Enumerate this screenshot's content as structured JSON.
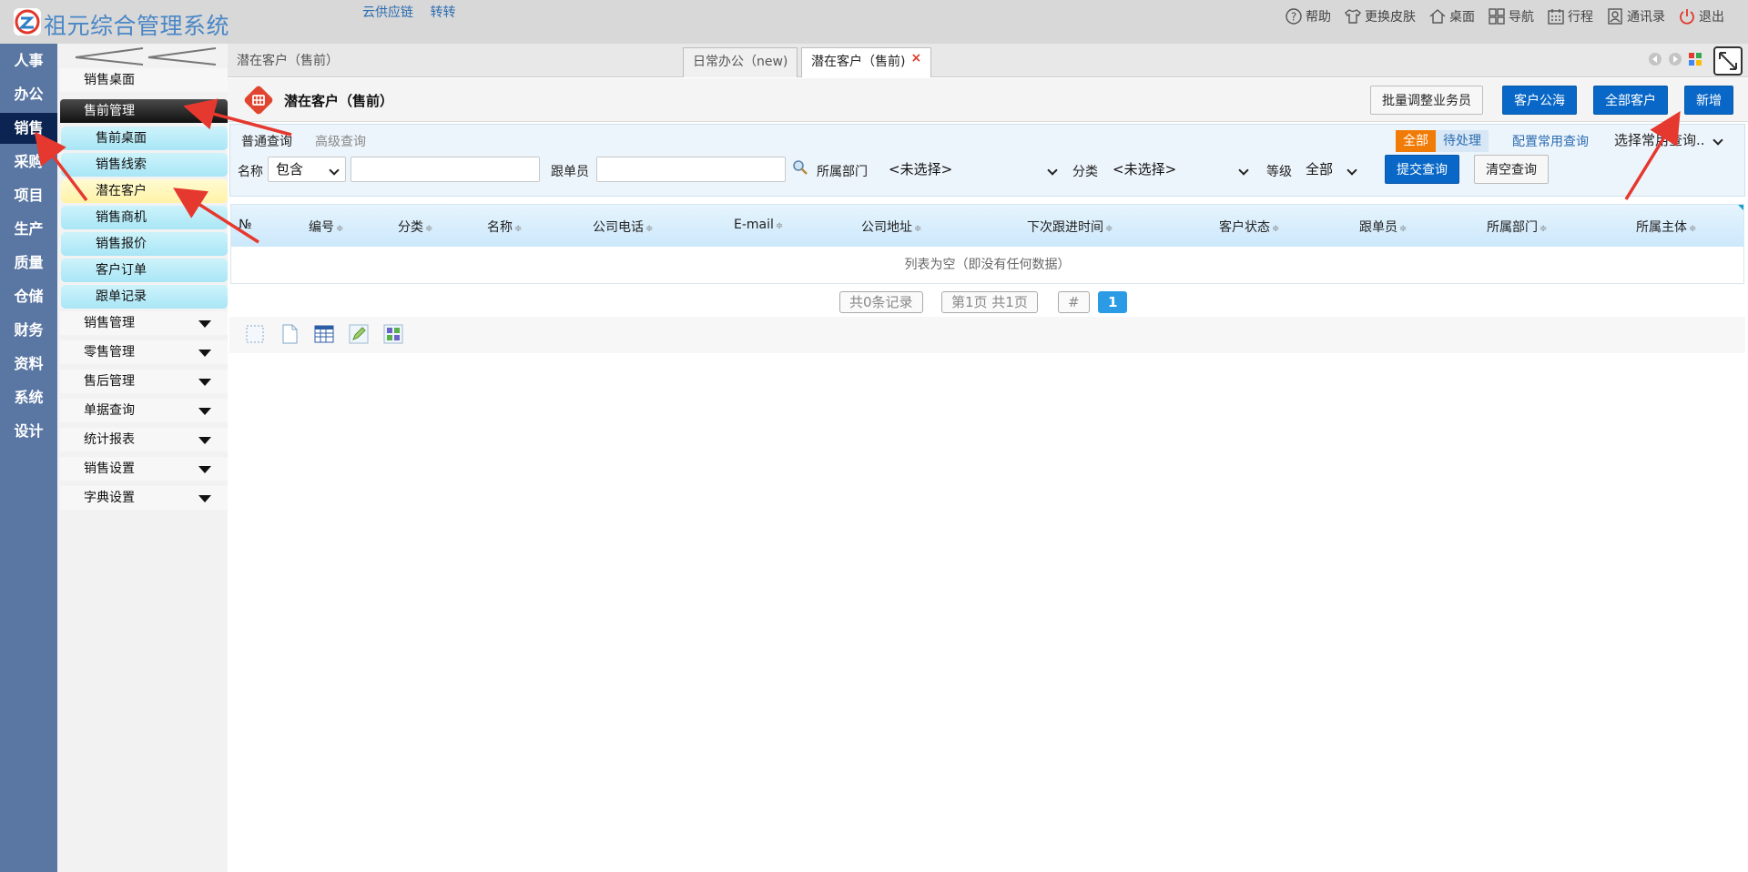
{
  "header": {
    "title": "祖元综合管理系统",
    "links": [
      "云供应链",
      "转转"
    ],
    "actions": [
      {
        "label": "帮助",
        "icon": "help-icon"
      },
      {
        "label": "更换皮肤",
        "icon": "shirt-icon"
      },
      {
        "label": "桌面",
        "icon": "home-icon"
      },
      {
        "label": "导航",
        "icon": "grid-icon"
      },
      {
        "label": "行程",
        "icon": "calendar-icon"
      },
      {
        "label": "通讯录",
        "icon": "contacts-icon"
      },
      {
        "label": "退出",
        "icon": "power-icon"
      }
    ]
  },
  "modules": [
    "人事",
    "办公",
    "销售",
    "采购",
    "项目",
    "生产",
    "质量",
    "仓储",
    "财务",
    "资料",
    "系统",
    "设计"
  ],
  "activeModule": "销售",
  "sidebar": {
    "top": "销售桌面",
    "presales": "售前管理",
    "presalesItems": [
      "售前桌面",
      "销售线索",
      "潜在客户",
      "销售商机",
      "销售报价",
      "客户订单",
      "跟单记录"
    ],
    "groups": [
      "销售管理",
      "零售管理",
      "售后管理",
      "单据查询",
      "统计报表",
      "销售设置",
      "字典设置"
    ]
  },
  "tabs": {
    "breadcrumb": "潜在客户（售前）",
    "items": [
      "日常办公（new)",
      "潜在客户（售前)"
    ],
    "close": "×"
  },
  "page": {
    "title": "潜在客户（售前）",
    "buttons": [
      "批量调整业务员",
      "客户公海",
      "全部客户",
      "新增"
    ]
  },
  "query": {
    "normal": "普通查询",
    "advanced": "高级查询",
    "segAll": "全部",
    "segPending": "待处理",
    "configLink": "配置常用查询",
    "commonSelect": "选择常用查询..",
    "nameLabel": "名称",
    "nameOp": "包含",
    "followerLabel": "跟单员",
    "deptLabel": "所属部门",
    "deptValue": "<未选择>",
    "categoryLabel": "分类",
    "categoryValue": "<未选择>",
    "levelLabel": "等级",
    "levelValue": "全部",
    "submit": "提交查询",
    "clear": "清空查询"
  },
  "table": {
    "columns": [
      "№",
      "编号",
      "分类",
      "名称",
      "公司电话",
      "E-mail",
      "公司地址",
      "下次跟进时间",
      "客户状态",
      "跟单员",
      "所属部门",
      "所属主体"
    ],
    "sortMark": "≑",
    "empty": "列表为空（即没有任何数据）"
  },
  "pager": {
    "records": "共0条记录",
    "pages": "第1页 共1页",
    "hash": "#",
    "current": "1"
  },
  "colors": {
    "header": "#d8d8d8",
    "moduleBar": "#5a77a3",
    "moduleActive": "#0c2451",
    "primaryButton": "#0968c7",
    "segmentOn": "#f07b06",
    "annotation": "#e5382e"
  }
}
